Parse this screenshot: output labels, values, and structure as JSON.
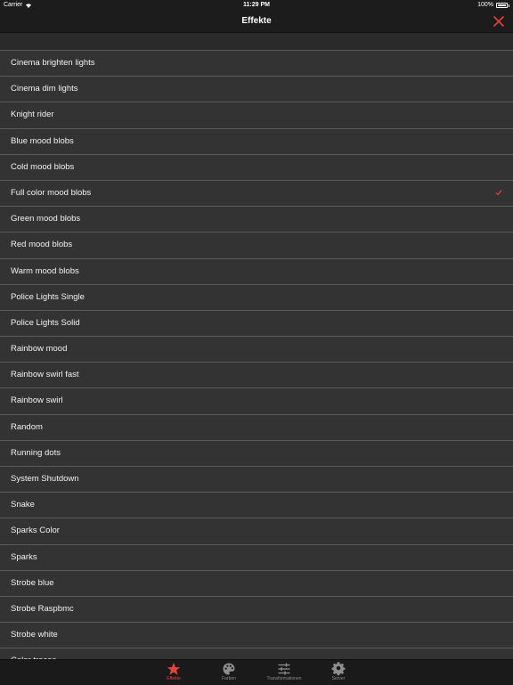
{
  "status_bar": {
    "carrier": "Carrier",
    "time": "11:29 PM",
    "battery": "100%"
  },
  "nav": {
    "title": "Effekte",
    "close_icon": "close-icon"
  },
  "accent_color": "#e4433a",
  "effects": [
    "Cinema brighten lights",
    "Cinema dim lights",
    "Knight rider",
    "Blue mood blobs",
    "Cold mood blobs",
    "Full color mood blobs",
    "Green mood blobs",
    "Red mood blobs",
    "Warm mood blobs",
    "Police Lights Single",
    "Police Lights Solid",
    "Rainbow mood",
    "Rainbow swirl fast",
    "Rainbow swirl",
    "Random",
    "Running dots",
    "System Shutdown",
    "Snake",
    "Sparks Color",
    "Sparks",
    "Strobe blue",
    "Strobe Raspbmc",
    "Strobe white",
    "Color traces"
  ],
  "selected_effect": "Full color mood blobs",
  "tabs": [
    {
      "label": "Effekte",
      "icon": "star-icon",
      "active": true
    },
    {
      "label": "Farben",
      "icon": "palette-icon",
      "active": false
    },
    {
      "label": "Transformationen",
      "icon": "sliders-icon",
      "active": false
    },
    {
      "label": "Server",
      "icon": "gear-icon",
      "active": false
    }
  ]
}
